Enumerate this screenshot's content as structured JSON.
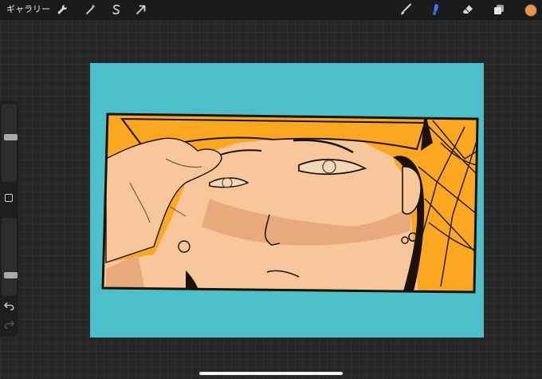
{
  "topbar": {
    "gallery_label": "ギャラリー",
    "left_tools": [
      {
        "name": "wrench-icon"
      },
      {
        "name": "magic-wand-icon"
      },
      {
        "name": "selection-s-icon"
      },
      {
        "name": "transform-arrow-icon"
      }
    ],
    "right_tools": [
      {
        "name": "brush-icon",
        "active": false
      },
      {
        "name": "smudge-icon",
        "active": true
      },
      {
        "name": "eraser-icon",
        "active": false
      },
      {
        "name": "layers-icon",
        "active": false
      }
    ],
    "current_color": "#e8954a",
    "active_tool_color": "#2f7cf6"
  },
  "sidebar": {
    "brush_size_level": 0.58,
    "opacity_level": 0.25,
    "icons": [
      "modify-square-icon",
      "undo-icon",
      "redo-icon"
    ]
  },
  "canvas": {
    "background": "#4cbfc8",
    "artwork_colors": {
      "hat": "#fba71f",
      "skin": "#f7c69a",
      "shadow": "#d9956a",
      "line": "#1a1208"
    }
  }
}
